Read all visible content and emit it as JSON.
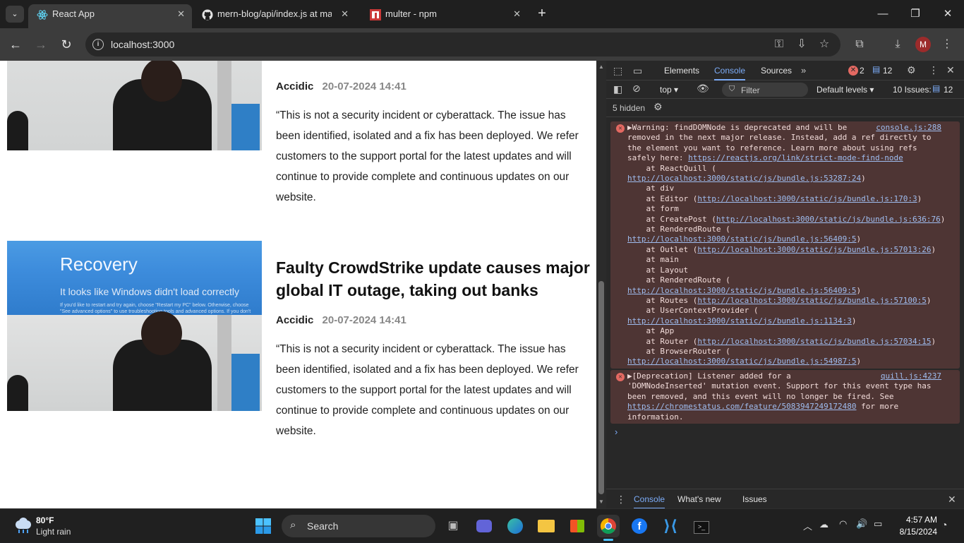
{
  "tabs": [
    {
      "title": "React App",
      "active": true
    },
    {
      "title": "mern-blog/api/index.js at mast",
      "active": false
    },
    {
      "title": "multer - npm",
      "active": false
    }
  ],
  "address": {
    "url": "localhost:3000"
  },
  "profile": {
    "initial": "M"
  },
  "posts": [
    {
      "title": "",
      "author": "Accidic",
      "date": "20-07-2024 14:41",
      "summary": "“This is not a security incident or cyberattack. The issue has been identified, isolated and a fix has been deployed. We refer customers to the support portal for the latest updates and will continue to provide complete and continuous updates on our website."
    },
    {
      "title": "Faulty CrowdStrike update causes major global IT outage, taking out banks",
      "author": "Accidic",
      "date": "20-07-2024 14:41",
      "summary": "“This is not a security incident or cyberattack. The issue has been identified, isolated and a fix has been deployed. We refer customers to the support portal for the latest updates and will continue to provide complete and continuous updates on our website.",
      "image_text": {
        "heading": "Recovery",
        "sub": "It looks like Windows didn't load correctly",
        "small": "If you'd like to restart and try again, choose \"Restart my PC\" below. Otherwise, choose \"See advanced options\" to use troubleshooting tools and advanced options. If you don't know which option is right for you, contact"
      }
    }
  ],
  "devtools": {
    "tabs": [
      "Elements",
      "Console",
      "Sources"
    ],
    "selected_tab": "Console",
    "error_count": "2",
    "message_count": "12",
    "context": "top",
    "filter_placeholder": "Filter",
    "levels": "Default levels",
    "issues_label": "10 Issues:",
    "issues_count": "12",
    "hidden": "5 hidden",
    "messages": [
      {
        "source": "console.js:288",
        "lines": [
          {
            "text": "▶Warning: findDOMNode is deprecated and will be"
          },
          {
            "text": "removed in the next major release. Instead, add a ref directly to"
          },
          {
            "text": "the element you want to reference. Learn more about using refs"
          },
          {
            "pre": "safely here: ",
            "link": "https://reactjs.org/link/strict-mode-find-node"
          },
          {
            "text": "    at ReactQuill ("
          },
          {
            "link": "http://localhost:3000/static/js/bundle.js:53287:24",
            "post": ")"
          },
          {
            "text": "    at div"
          },
          {
            "pre": "    at Editor (",
            "link": "http://localhost:3000/static/js/bundle.js:170:3",
            "post": ")"
          },
          {
            "text": "    at form"
          },
          {
            "pre": "    at CreatePost (",
            "link": "http://localhost:3000/static/js/bundle.js:636:76",
            "post": ")"
          },
          {
            "text": "    at RenderedRoute ("
          },
          {
            "link": "http://localhost:3000/static/js/bundle.js:56409:5",
            "post": ")"
          },
          {
            "pre": "    at Outlet (",
            "link": "http://localhost:3000/static/js/bundle.js:57013:26",
            "post": ")"
          },
          {
            "text": "    at main"
          },
          {
            "text": "    at Layout"
          },
          {
            "text": "    at RenderedRoute ("
          },
          {
            "link": "http://localhost:3000/static/js/bundle.js:56409:5",
            "post": ")"
          },
          {
            "pre": "    at Routes (",
            "link": "http://localhost:3000/static/js/bundle.js:57100:5",
            "post": ")"
          },
          {
            "text": "    at UserContextProvider ("
          },
          {
            "link": "http://localhost:3000/static/js/bundle.js:1134:3",
            "post": ")"
          },
          {
            "text": "    at App"
          },
          {
            "pre": "    at Router (",
            "link": "http://localhost:3000/static/js/bundle.js:57034:15",
            "post": ")"
          },
          {
            "text": "    at BrowserRouter ("
          },
          {
            "link": "http://localhost:3000/static/js/bundle.js:54987:5",
            "post": ")"
          }
        ]
      },
      {
        "source": "quill.js:4237",
        "lines": [
          {
            "text": "▶[Deprecation] Listener added for a"
          },
          {
            "text": "'DOMNodeInserted' mutation event. Support for this event type has"
          },
          {
            "text": "been removed, and this event will no longer be fired. See"
          },
          {
            "link": "https://chromestatus.com/feature/5083947249172480",
            "post": " for more"
          },
          {
            "text": "information."
          }
        ]
      }
    ],
    "drawer_tabs": [
      "Console",
      "What's new",
      "Issues"
    ]
  },
  "taskbar": {
    "temperature": "80°F",
    "condition": "Light rain",
    "search_label": "Search",
    "time": "4:57 AM",
    "date": "8/15/2024"
  }
}
